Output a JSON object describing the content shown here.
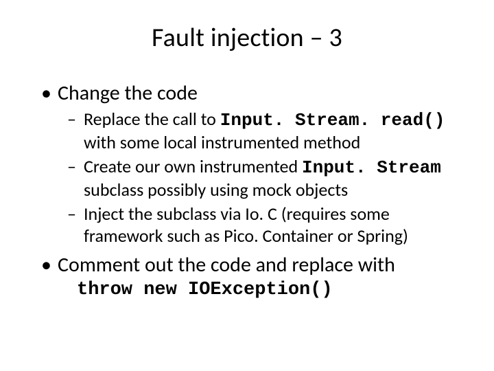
{
  "title": "Fault injection – 3",
  "bullets": {
    "b1": {
      "text": "Change the code",
      "sub": {
        "s1": {
          "pre": "Replace the call to ",
          "code": "Input. Stream. read()",
          "post": " with some local instrumented method"
        },
        "s2": {
          "pre": "Create our own instrumented ",
          "code": "Input. Stream",
          "post": " subclass possibly using mock objects"
        },
        "s3": {
          "pre": "Inject the subclass via Io. C (requires some framework such as Pico. Container or Spring)",
          "code": "",
          "post": ""
        }
      }
    },
    "b2": {
      "text": "Comment out the code and replace with",
      "codeLine": "throw new IOException()"
    }
  }
}
